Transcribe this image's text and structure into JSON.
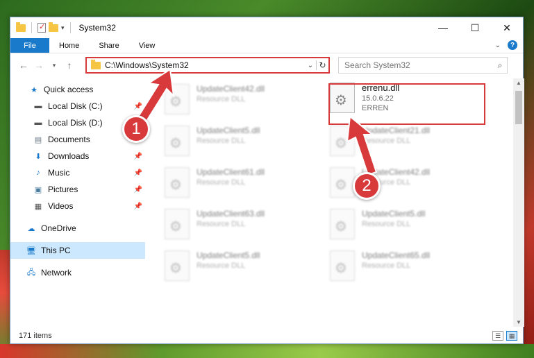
{
  "window": {
    "title": "System32",
    "controls": {
      "minimize": "—",
      "maximize": "☐",
      "close": "✕"
    }
  },
  "ribbon": {
    "tabs": [
      "File",
      "Home",
      "Share",
      "View"
    ],
    "chevron": "⌄",
    "help": "?"
  },
  "address": {
    "path": "C:\\Windows\\System32",
    "search_placeholder": "Search System32"
  },
  "sidebar": {
    "items": [
      {
        "label": "Quick access",
        "icon": "star-icon",
        "pinned": false
      },
      {
        "label": "Local Disk (C:)",
        "icon": "drive-icon",
        "pinned": true
      },
      {
        "label": "Local Disk (D:)",
        "icon": "drive-icon",
        "pinned": true
      },
      {
        "label": "Documents",
        "icon": "documents-icon",
        "pinned": true
      },
      {
        "label": "Downloads",
        "icon": "download-icon",
        "pinned": true
      },
      {
        "label": "Music",
        "icon": "music-icon",
        "pinned": true
      },
      {
        "label": "Pictures",
        "icon": "pictures-icon",
        "pinned": true
      },
      {
        "label": "Videos",
        "icon": "videos-icon",
        "pinned": true
      },
      {
        "label": "OneDrive",
        "icon": "cloud-icon",
        "pinned": false
      },
      {
        "label": "This PC",
        "icon": "computer-icon",
        "pinned": false,
        "active": true
      },
      {
        "label": "Network",
        "icon": "network-icon",
        "pinned": false
      }
    ]
  },
  "files": {
    "left_column": [
      {
        "name": "UpdateClient42.dll",
        "type": "Resource DLL"
      },
      {
        "name": "UpdateClient5.dll",
        "type": "Resource DLL"
      },
      {
        "name": "UpdateClient61.dll",
        "type": "Resource DLL"
      },
      {
        "name": "UpdateClient63.dll",
        "type": "Resource DLL"
      },
      {
        "name": "UpdateClient5.dll",
        "type": "Resource DLL"
      }
    ],
    "right_column": [
      {
        "name": "errenu.dll",
        "type": "15.0.6.22",
        "extra": "ERREN"
      },
      {
        "name": "UpdateClient21.dll",
        "type": "Resource DLL"
      },
      {
        "name": "UpdateClient42.dll",
        "type": "Resource DLL"
      },
      {
        "name": "UpdateClient5.dll",
        "type": "Resource DLL"
      },
      {
        "name": "UpdateClient65.dll",
        "type": "Resource DLL"
      }
    ]
  },
  "status": {
    "items_count": "171 items"
  },
  "annotations": {
    "step1": "1",
    "step2": "2"
  },
  "colors": {
    "accent": "#1979ca",
    "highlight": "#d8393b",
    "selected": "#cce8ff"
  }
}
